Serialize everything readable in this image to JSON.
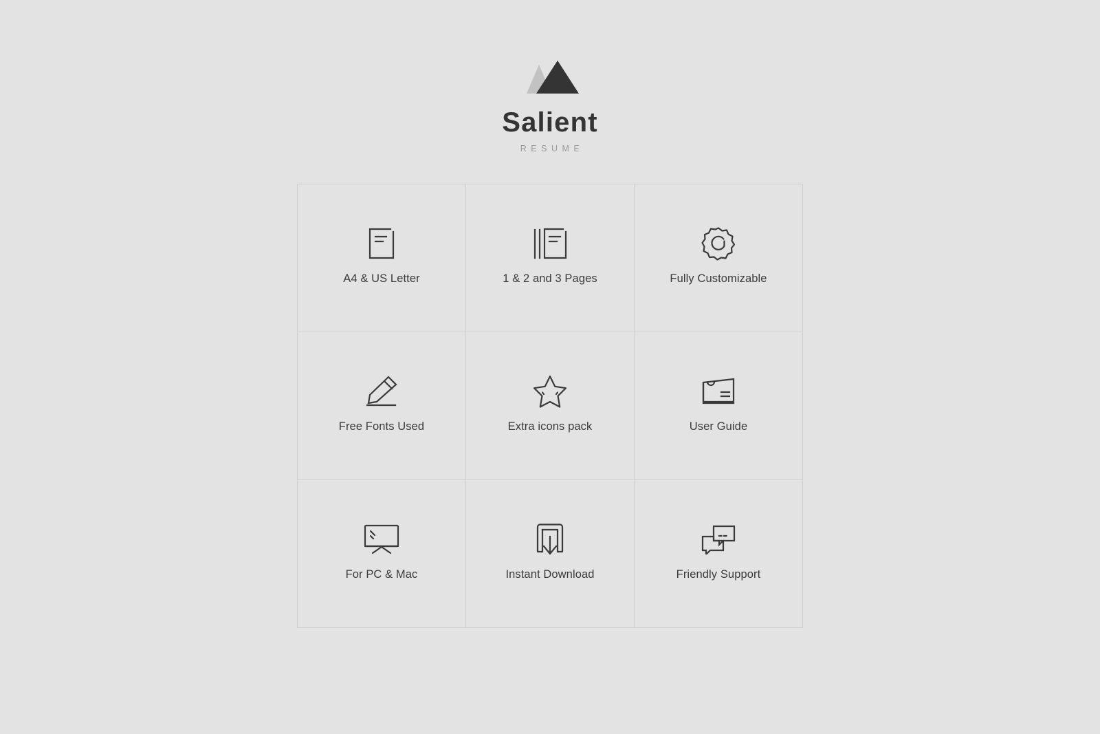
{
  "brand": {
    "name": "Salient",
    "subtitle": "RESUME",
    "logo_icon": "mountain-logo-icon",
    "logo_color_dark": "#343434",
    "logo_color_light": "#c2c2c2"
  },
  "theme": {
    "background": "#e3e3e3",
    "grid_line": "#cfcfcf",
    "icon_color": "#3a3a3a",
    "label_color": "#3a3a3a",
    "subtitle_color": "#9a9a9a"
  },
  "features": [
    {
      "label": "A4 & US Letter",
      "icon": "document-icon"
    },
    {
      "label": "1 & 2 and 3 Pages",
      "icon": "stacked-pages-icon"
    },
    {
      "label": "Fully Customizable",
      "icon": "gear-icon"
    },
    {
      "label": "Free Fonts Used",
      "icon": "pen-writing-icon"
    },
    {
      "label": "Extra icons pack",
      "icon": "star-icon"
    },
    {
      "label": "User Guide",
      "icon": "folder-icon"
    },
    {
      "label": "For PC & Mac",
      "icon": "monitor-icon"
    },
    {
      "label": "Instant Download",
      "icon": "download-icon"
    },
    {
      "label": "Friendly Support",
      "icon": "chat-bubbles-icon"
    }
  ]
}
